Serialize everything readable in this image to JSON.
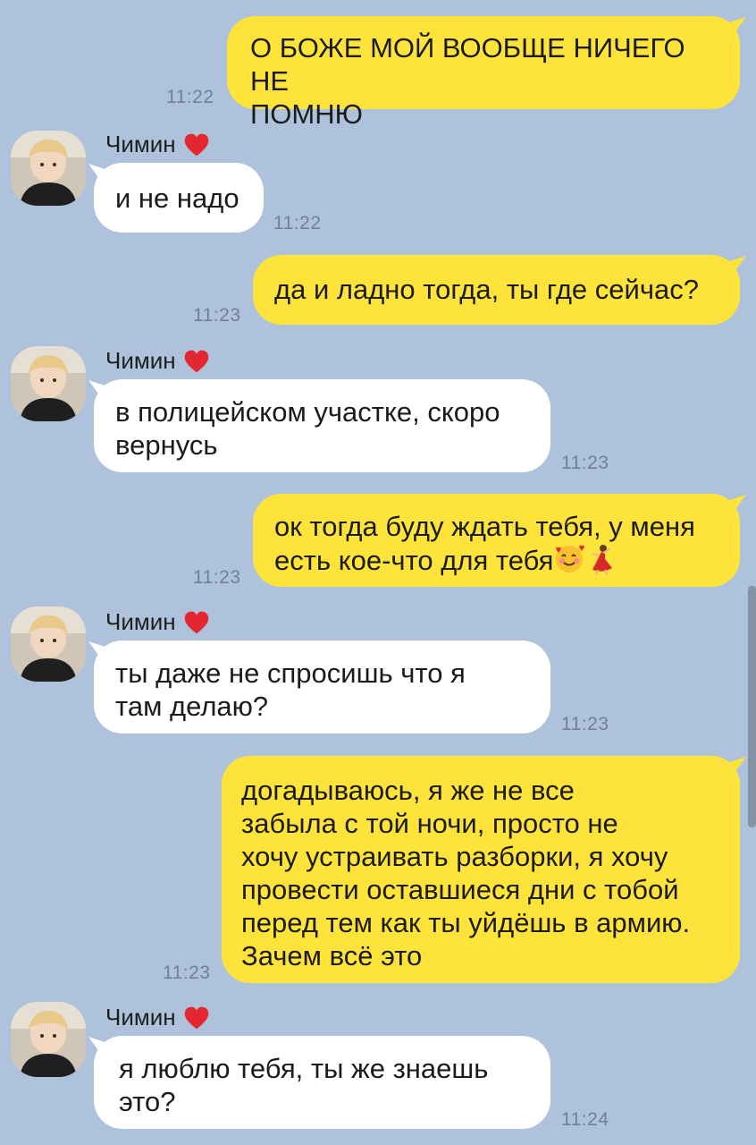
{
  "contact": {
    "name": "Чимин"
  },
  "messages": [
    {
      "direction": "out",
      "text": "О БОЖЕ МОЙ ВООБЩЕ НИЧЕГО НЕ\nПОМНЮ",
      "time": "11:22"
    },
    {
      "direction": "in",
      "sender": "Чимин",
      "text": "и не надо",
      "time": "11:22"
    },
    {
      "direction": "out",
      "text": "да и ладно тогда, ты где сейчас?",
      "time": "11:23"
    },
    {
      "direction": "in",
      "sender": "Чимин",
      "text": "в полицейском участке, скоро\nвернусь",
      "time": "11:23"
    },
    {
      "direction": "out",
      "text_line1": "ок тогда буду ждать тебя, у меня",
      "text_line2": "есть кое-что для тебя",
      "emojis": [
        "smiling-face-with-hearts",
        "woman-dancing"
      ],
      "time": "11:23"
    },
    {
      "direction": "in",
      "sender": "Чимин",
      "text": "ты даже не спросишь что я\nтам делаю?",
      "time": "11:23"
    },
    {
      "direction": "out",
      "text": "догадываюсь, я же не все\nзабыла с той ночи, просто не\nхочу устраивать разборки, я хочу\nпровести оставшиеся дни с тобой\nперед тем как ты уйдёшь в армию.\nЗачем всё это",
      "time": "11:23"
    },
    {
      "direction": "in",
      "sender": "Чимин",
      "text": "я люблю тебя, ты же знаешь\nэто?",
      "time": "11:24"
    }
  ],
  "colors": {
    "background": "#aec3db",
    "outgoing_bubble": "#fee33a",
    "incoming_bubble": "#ffffff",
    "heart": "#e3262f"
  },
  "icons": {
    "sender_badge": "red-heart-icon",
    "avatar": "contact-photo-avatar"
  }
}
